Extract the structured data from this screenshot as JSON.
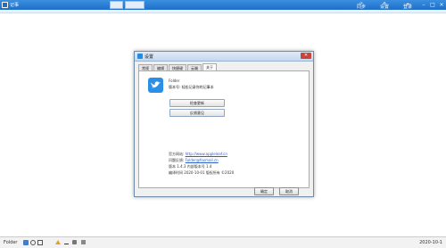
{
  "app": {
    "title": "记事",
    "brand_color": "#1d6fc8"
  },
  "header": {
    "buttons": [
      {
        "label": "同步",
        "icon": "refresh-icon"
      },
      {
        "label": "设置",
        "icon": "gear-icon"
      },
      {
        "label": "登录",
        "icon": "cloud-icon"
      }
    ]
  },
  "dialog": {
    "title": "设置",
    "tabs": [
      "常规",
      "编辑",
      "快捷键",
      "云端",
      "关于"
    ],
    "active_tab": "关于",
    "about": {
      "app_name": "Folder",
      "version_line": "版本号: 轻松记录你的记事本",
      "check_update": "检查更新",
      "feedback": "反馈意见",
      "website_label": "官方网站:",
      "website_url": "http://www.appleleaf.cn",
      "email_label": "问题反馈:",
      "email": "Folder@foxmail.cn",
      "version_info": "版本 1.4.3 内部版本号 1.4",
      "build_info": "编译时间 2020-10-01 版权所有 ©2020"
    },
    "ok": "确定",
    "cancel": "取消"
  },
  "taskbar": {
    "left_label": "Folder",
    "right_label": "2020-10-1"
  }
}
